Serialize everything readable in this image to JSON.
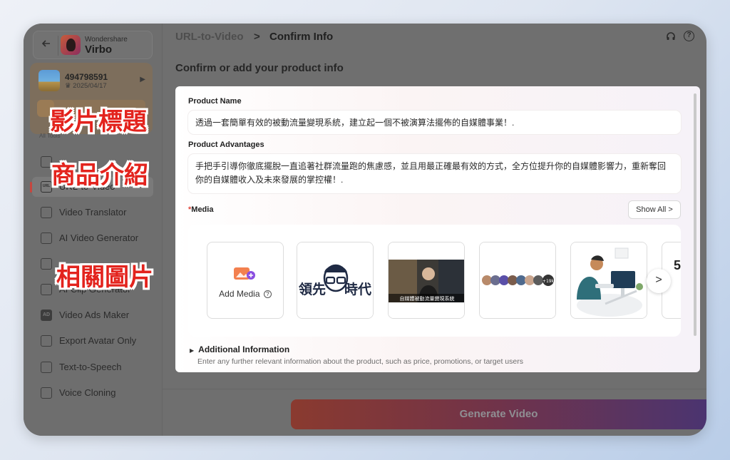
{
  "sidebar": {
    "back_icon": "arrow-left-icon",
    "brand_small": "Wondershare",
    "brand_name": "Virbo",
    "account": {
      "id": "494798591",
      "date": "2025/04/17"
    },
    "section_label": "All Tools",
    "items": [
      {
        "label": "",
        "icon": "image-icon"
      },
      {
        "label": "URL-to-Video",
        "icon": "url-icon",
        "active": true
      },
      {
        "label": "Video Translator",
        "icon": "translate-icon"
      },
      {
        "label": "AI Video Generator",
        "icon": "video-generator-icon"
      },
      {
        "label": "",
        "icon": "music-icon"
      },
      {
        "label": "AI Clip Generator",
        "icon": "clip-icon"
      },
      {
        "label": "Video Ads Maker",
        "icon": "ads-icon"
      },
      {
        "label": "Export Avatar Only",
        "icon": "avatar-export-icon"
      },
      {
        "label": "Text-to-Speech",
        "icon": "tts-icon"
      },
      {
        "label": "Voice Cloning",
        "icon": "voice-icon"
      }
    ]
  },
  "header": {
    "crumb_1": "URL-to-Video",
    "crumb_sep": ">",
    "crumb_2": "Confirm Info",
    "support_icon": "headset-icon",
    "help_icon": "question-circle-icon"
  },
  "main": {
    "heading": "Confirm or add your product info",
    "product_name_label": "Product Name",
    "product_name_value": "透過一套簡單有效的被動流量變現系統，建立起一個不被演算法擺佈的自媒體事業！.",
    "product_adv_label": "Product Advantages",
    "product_adv_value": "手把手引導你徹底擺脫一直追著社群流量跑的焦慮感，並且用最正確最有效的方式，全方位提升你的自媒體影響力，重新奪回你的自媒體收入及未來發展的掌控權！.",
    "media_required": "*",
    "media_label": "Media",
    "show_all": "Show All  >",
    "add_media": "Add Media",
    "thumb_logo_text": "領先",
    "thumb_logo_text2": "時代",
    "thumb_video_caption": "自媒體被動流量變現系統",
    "thumb_faces_count": "+19k",
    "thumb_partial": "5",
    "next_arrow": ">",
    "additional_title": "Additional Information",
    "additional_desc": "Enter any further relevant information about the product, such as price, promotions, or target users",
    "generate_button": "Generate Video"
  },
  "annotations": {
    "label_1": "影片標題",
    "label_2": "商品介紹",
    "label_3": "相關圖片"
  },
  "colors": {
    "annotation_red": "#e3231d",
    "required_red": "#e0453a",
    "active_marker": "#c6473f"
  }
}
